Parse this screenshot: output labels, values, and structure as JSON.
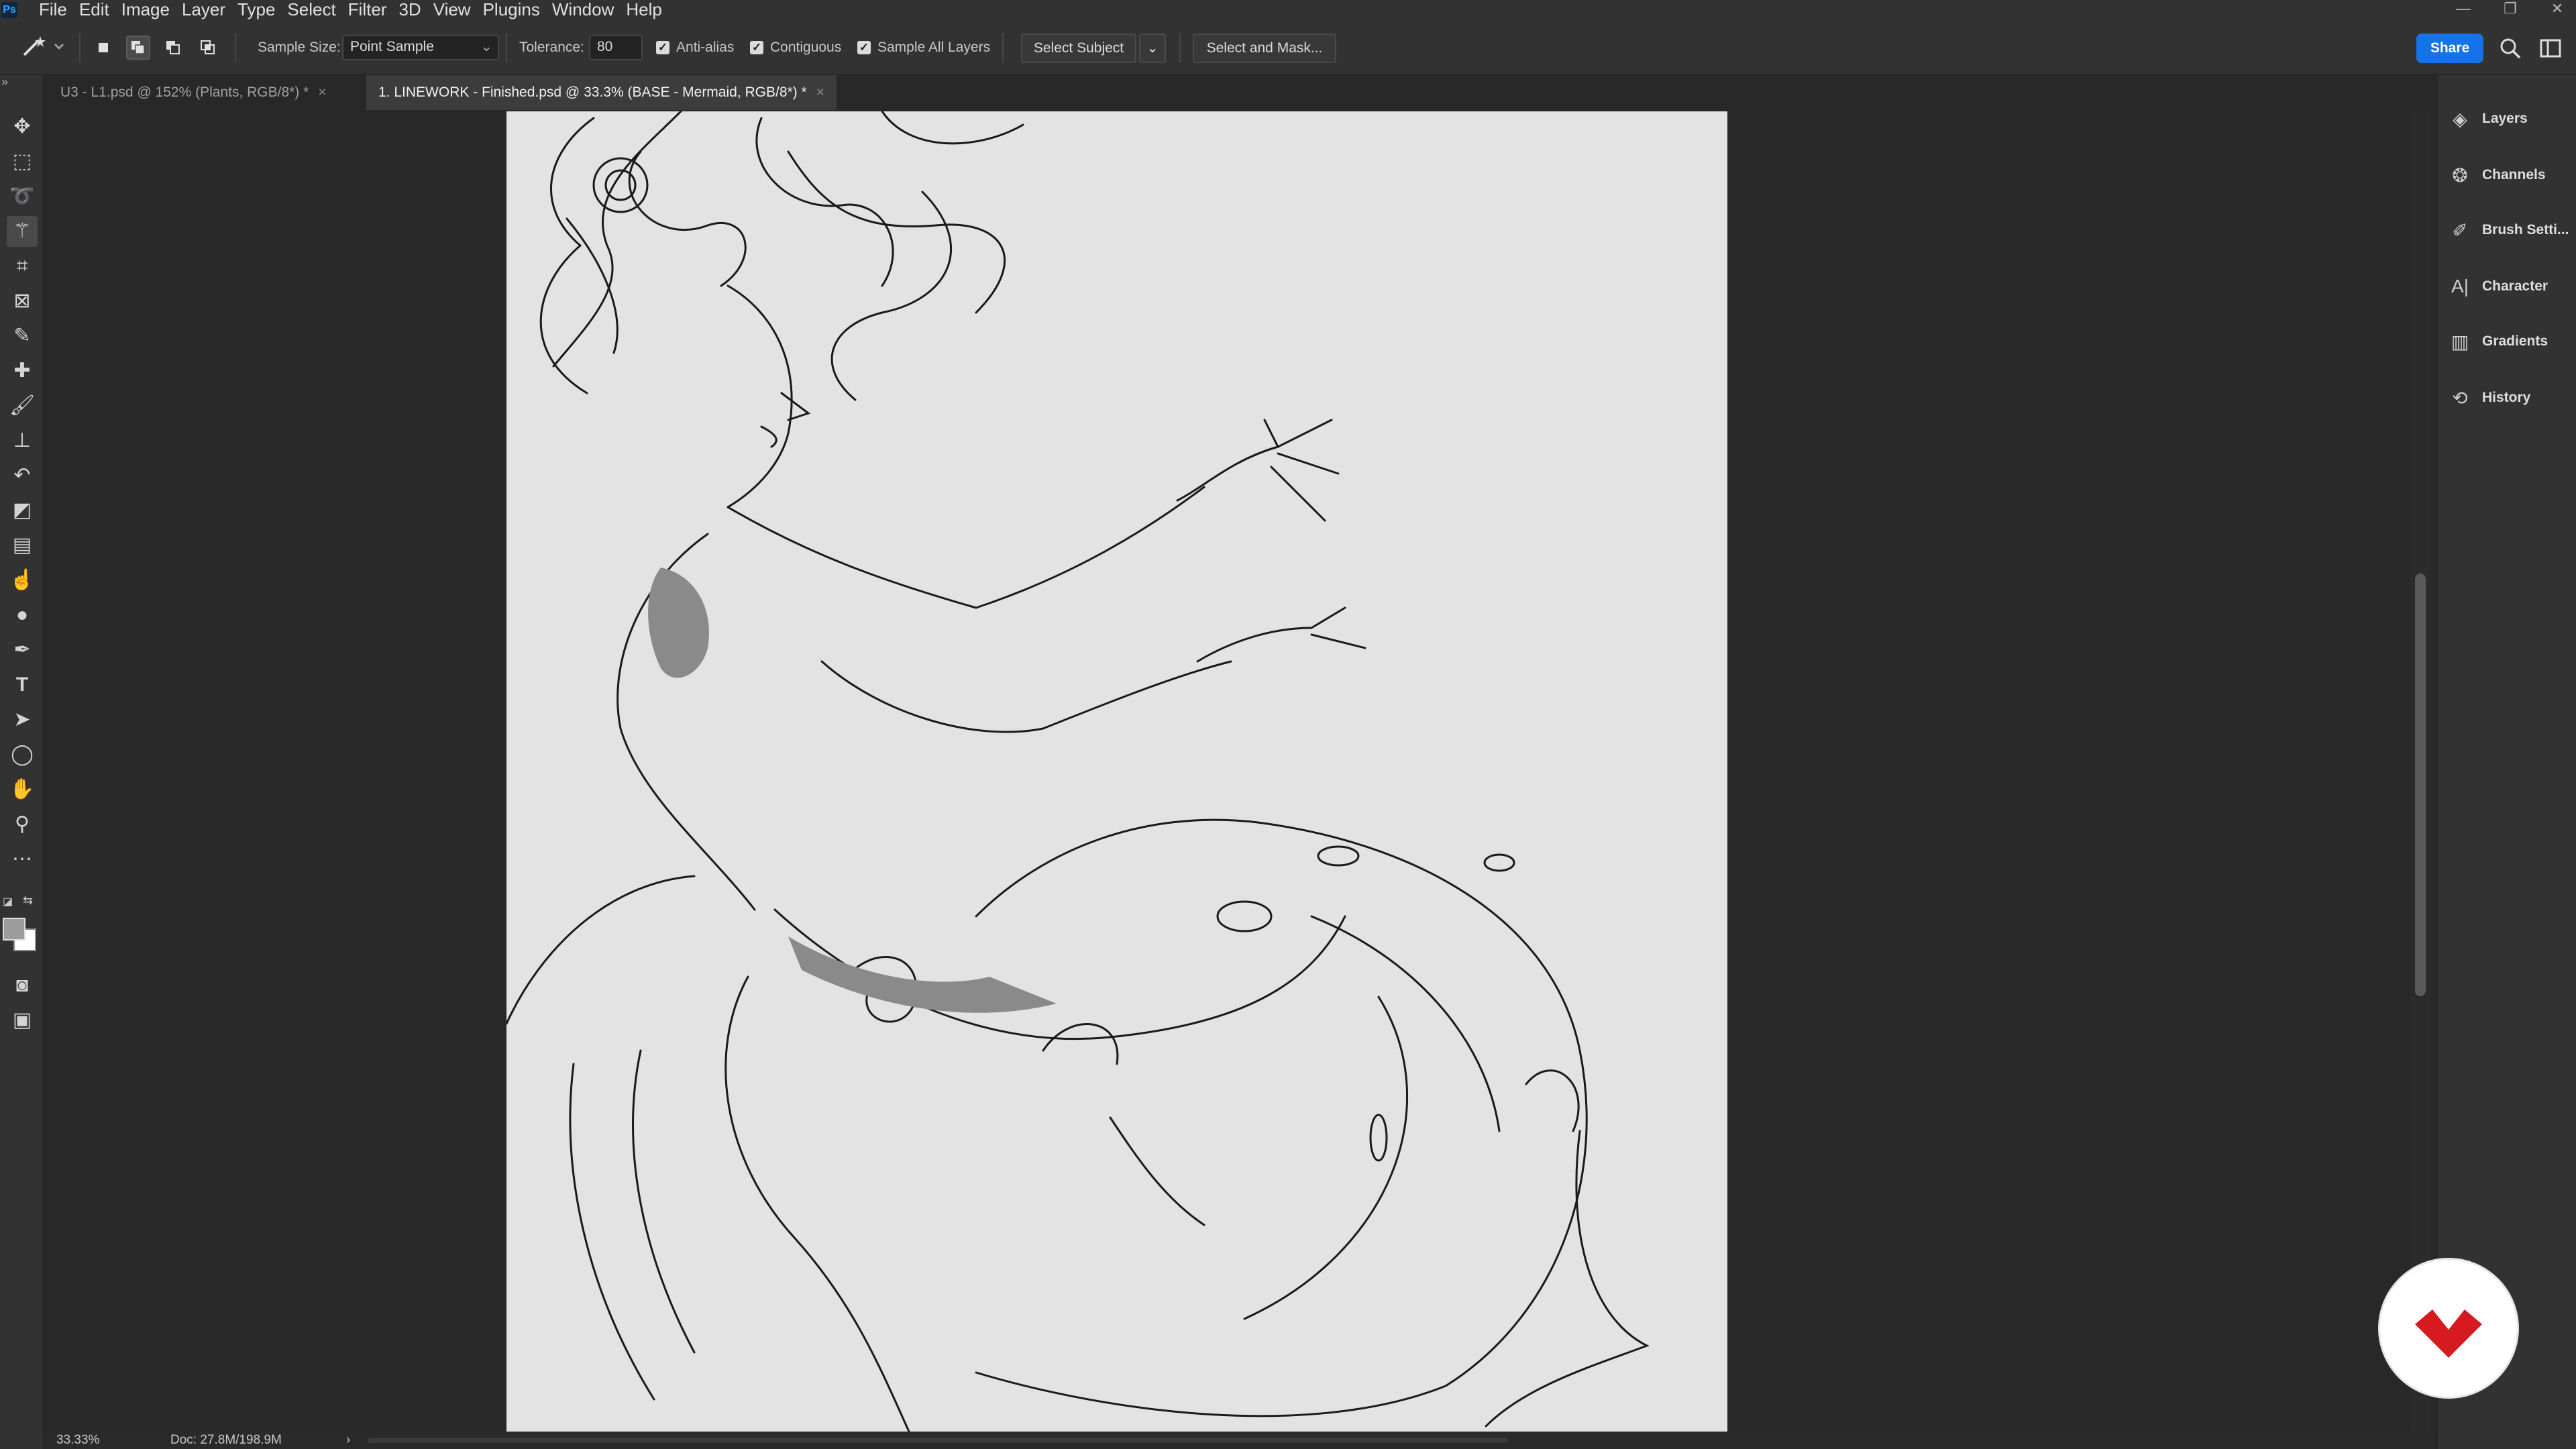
{
  "app": {
    "logo_text": "Ps"
  },
  "menu": [
    "File",
    "Edit",
    "Image",
    "Layer",
    "Type",
    "Select",
    "Filter",
    "3D",
    "View",
    "Plugins",
    "Window",
    "Help"
  ],
  "window_controls": {
    "minimize": "—",
    "restore": "❐",
    "close": "✕"
  },
  "options": {
    "sample_size_label": "Sample Size:",
    "sample_size_value": "Point Sample",
    "tolerance_label": "Tolerance:",
    "tolerance_value": "80",
    "anti_alias_label": "Anti-alias",
    "anti_alias_checked": true,
    "contiguous_label": "Contiguous",
    "contiguous_checked": true,
    "sample_all_layers_label": "Sample All Layers",
    "sample_all_layers_checked": true,
    "select_subject_label": "Select Subject",
    "select_and_mask_label": "Select and Mask...",
    "share_label": "Share"
  },
  "tabs": [
    {
      "label": "U3 - L1.psd @ 152% (Plants, RGB/8*) *",
      "active": false
    },
    {
      "label": "1. LINEWORK - Finished.psd @ 33.3% (BASE - Mermaid, RGB/8*) *",
      "active": true
    }
  ],
  "tab_close_glyph": "×",
  "tools": [
    "move-tool-icon",
    "marquee-tool-icon",
    "lasso-tool-icon",
    "magic-wand-tool-icon",
    "crop-tool-icon",
    "frame-tool-icon",
    "eyedropper-tool-icon",
    "healing-brush-icon",
    "brush-tool-icon",
    "clone-stamp-icon",
    "history-brush-icon",
    "eraser-tool-icon",
    "gradient-tool-icon",
    "smudge-tool-icon",
    "dodge-tool-icon",
    "pen-tool-icon",
    "type-tool-icon",
    "path-selection-icon",
    "ellipse-tool-icon",
    "hand-tool-icon",
    "zoom-tool-icon",
    "more-tools-icon"
  ],
  "panels": [
    {
      "label": "Layers",
      "icon": "layers-icon"
    },
    {
      "label": "Channels",
      "icon": "channels-icon"
    },
    {
      "label": "Brush Setti...",
      "icon": "brush-settings-icon"
    },
    {
      "label": "Character",
      "icon": "character-icon"
    },
    {
      "label": "Gradients",
      "icon": "gradients-icon"
    },
    {
      "label": "History",
      "icon": "history-icon"
    }
  ],
  "status": {
    "zoom": "33.33%",
    "doc_size": "Doc: 27.8M/198.9M",
    "arrow": "›"
  },
  "colors": {
    "accent": "#1473e6",
    "badge_red": "#d71920",
    "foreground_swatch": "#9c9c9c",
    "background_swatch": "#ffffff"
  }
}
